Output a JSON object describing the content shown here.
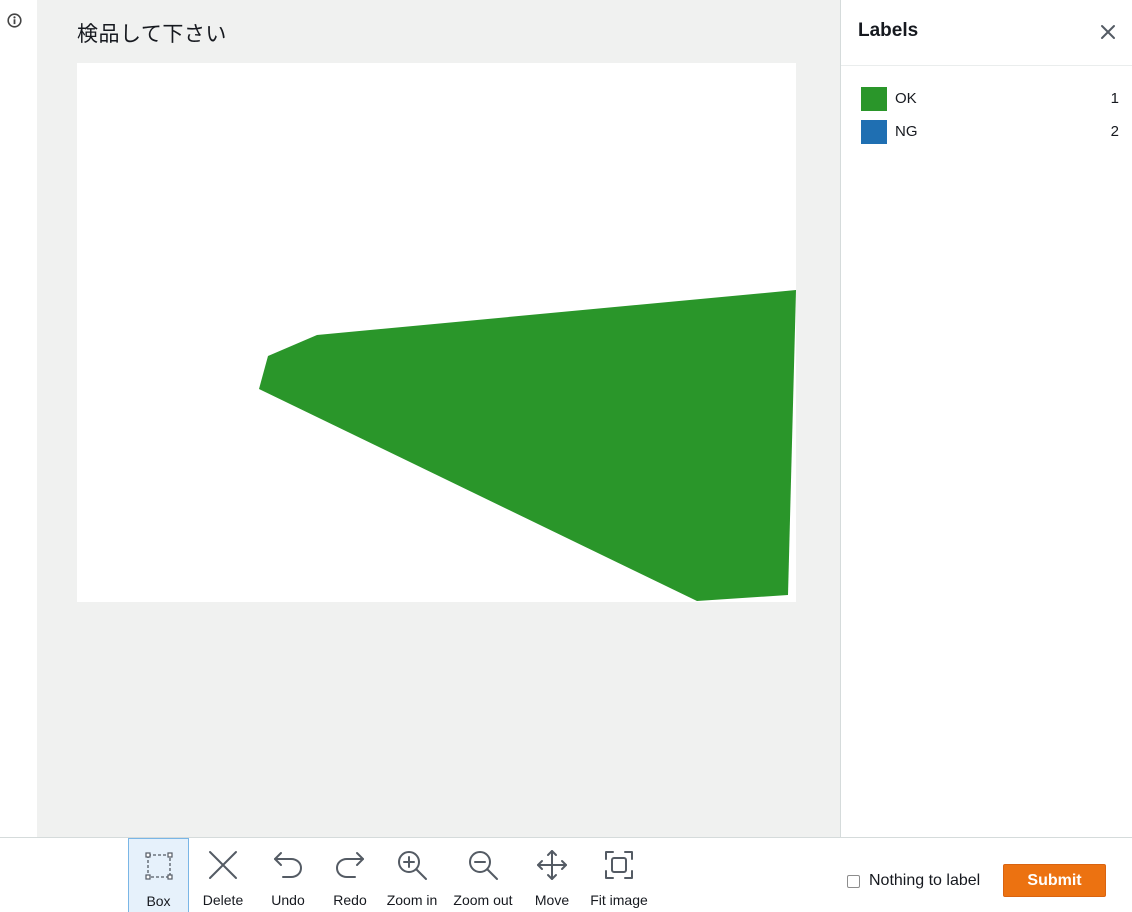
{
  "instruction": {
    "title": "検品して下さい"
  },
  "labels_panel": {
    "title": "Labels",
    "labels": [
      {
        "name": "OK",
        "key": "1",
        "color": "#2a962a"
      },
      {
        "name": "NG",
        "key": "2",
        "color": "#1f6fb2"
      }
    ]
  },
  "annotation": {
    "label": "OK",
    "fill": "#2a962a"
  },
  "toolbar": {
    "tools": [
      {
        "label": "Box",
        "icon": "box-icon",
        "active": true
      },
      {
        "label": "Delete",
        "icon": "delete-x-icon"
      },
      {
        "label": "Undo",
        "icon": "undo-icon"
      },
      {
        "label": "Redo",
        "icon": "redo-icon"
      },
      {
        "label": "Zoom in",
        "icon": "zoom-in-icon"
      },
      {
        "label": "Zoom out",
        "icon": "zoom-out-icon"
      },
      {
        "label": "Move",
        "icon": "move-icon"
      },
      {
        "label": "Fit image",
        "icon": "fit-image-icon"
      }
    ],
    "nothing_to_label": "Nothing to label",
    "submit": "Submit"
  },
  "colors": {
    "accent": "#ec7211",
    "workspace_bg": "#f0f1f0",
    "active_tool_bg": "#e6f1fb"
  }
}
